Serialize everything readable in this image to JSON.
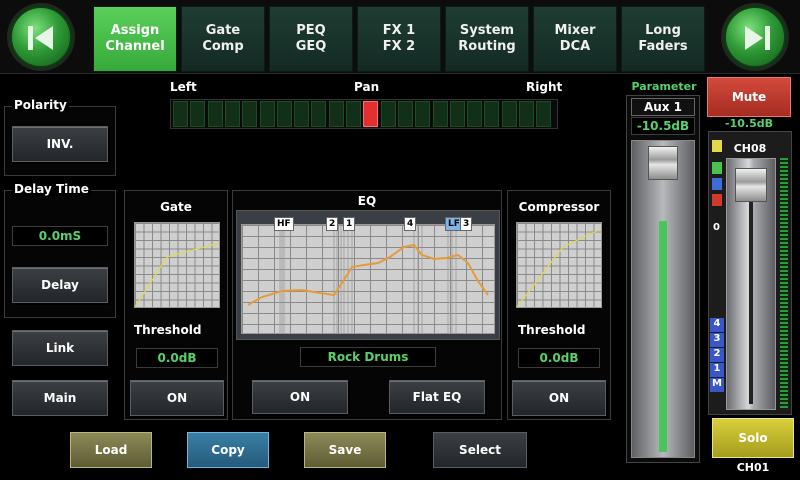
{
  "nav": {
    "prev_icon": "rewind-icon",
    "next_icon": "fast-forward-icon"
  },
  "tabs": [
    {
      "label": "Assign\nChannel",
      "active": true
    },
    {
      "label": "Gate\nComp",
      "active": false
    },
    {
      "label": "PEQ\nGEQ",
      "active": false
    },
    {
      "label": "FX 1\nFX 2",
      "active": false
    },
    {
      "label": "System\nRouting",
      "active": false
    },
    {
      "label": "Mixer\nDCA",
      "active": false
    },
    {
      "label": "Long\nFaders",
      "active": false
    }
  ],
  "pan": {
    "left_label": "Left",
    "center_label": "Pan",
    "right_label": "Right",
    "segments": 22,
    "active_segment": 11
  },
  "polarity": {
    "title": "Polarity",
    "button": "INV."
  },
  "delay": {
    "title": "Delay Time",
    "value": "0.0mS",
    "button": "Delay"
  },
  "link_button": "Link",
  "main_button": "Main",
  "gate": {
    "title": "Gate",
    "threshold_label": "Threshold",
    "threshold_value": "0.0dB",
    "on_button": "ON"
  },
  "eq": {
    "title": "EQ",
    "preset": "Rock Drums",
    "on_button": "ON",
    "flat_button": "Flat EQ",
    "markers": [
      "HF",
      "2",
      "1",
      "4",
      "LF",
      "3"
    ]
  },
  "compressor": {
    "title": "Compressor",
    "threshold_label": "Threshold",
    "threshold_value": "0.0dB",
    "on_button": "ON"
  },
  "bottom": {
    "load": "Load",
    "copy": "Copy",
    "save": "Save",
    "select": "Select"
  },
  "parameter": {
    "title": "Parameter",
    "bus": "Aux 1",
    "value": "-10.5dB",
    "level": 0.85
  },
  "channel": {
    "mute": "Mute",
    "value": "-10.5dB",
    "name": "CH08",
    "zero_mark": "0",
    "scale": [
      "4",
      "3",
      "2",
      "1",
      "M"
    ],
    "solo": "Solo",
    "footer": "CH01"
  },
  "colors": {
    "accent_green": "#3cb43f",
    "mute_red": "#c8392e",
    "solo_yellow": "#c9c12a",
    "readout_green": "#59d16a"
  }
}
